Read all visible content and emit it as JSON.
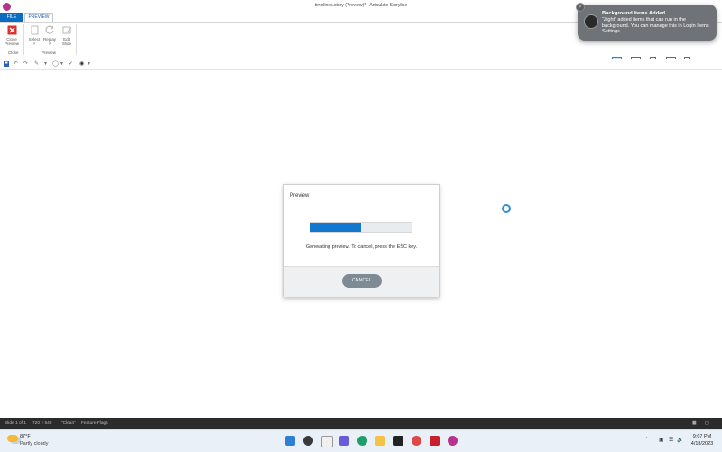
{
  "window": {
    "title": "timelines.story (Preview)* - Articulate Storyline"
  },
  "tabs": {
    "file": "FILE",
    "preview": "PREVIEW"
  },
  "ribbon": {
    "close_preview": {
      "line1": "Close",
      "line2": "Preview"
    },
    "group_close": "Close",
    "select": "Select",
    "replay": "Replay",
    "edit_slide": {
      "line1": "Edit",
      "line2": "Slide"
    },
    "group_preview": "Preview",
    "dropdown_marker": "˅"
  },
  "dialog": {
    "title": "Preview",
    "progress": 0.5,
    "message": "Generating preview.  To cancel, press the ESC key.",
    "cancel_label": "CANCEL"
  },
  "notification": {
    "title": "Background Items Added",
    "body": "“Zight” added items that can run in the background. You can manage this in Login Items Settings."
  },
  "status_bar": {
    "slide": "Slide 1 of 1",
    "size": "720 × 540",
    "theme": "“Clean”",
    "flags": "Feature Flags"
  },
  "taskbar": {
    "weather_temp": "87°F",
    "weather_condition": "Partly cloudy",
    "time": "9:07 PM",
    "date": "4/18/2023"
  },
  "colors": {
    "accent": "#0a6dc2",
    "progress": "#1277cf",
    "cancel": "#7e8a94",
    "status_bar": "#2b2b2b"
  }
}
